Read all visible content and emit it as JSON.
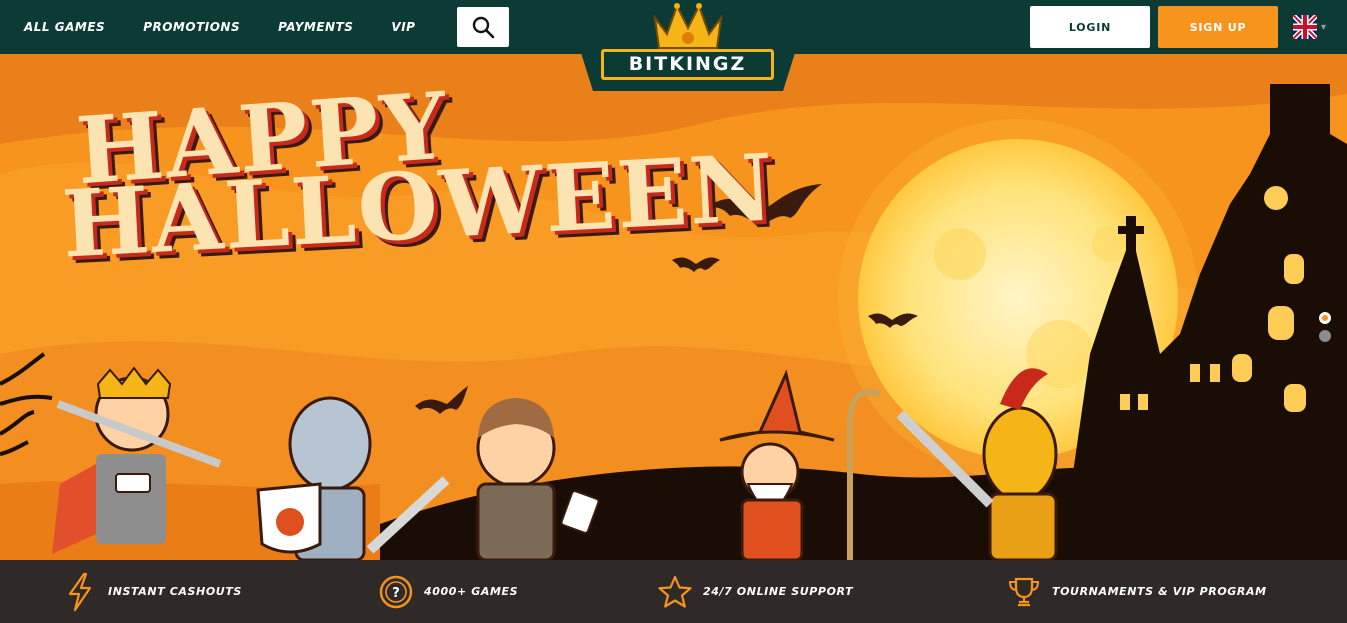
{
  "nav": {
    "items": [
      {
        "label": "ALL GAMES"
      },
      {
        "label": "PROMOTIONS"
      },
      {
        "label": "PAYMENTS"
      },
      {
        "label": "VIP"
      }
    ]
  },
  "logo": {
    "text": "BITKINGZ"
  },
  "auth": {
    "login_label": "LOGIN",
    "signup_label": "SIGN UP"
  },
  "language": {
    "flag": "uk-flag-icon"
  },
  "hero": {
    "headline_line1": "HAPPY",
    "headline_line2": "HALLOWEEN",
    "slides": {
      "count": 2,
      "active": 0
    }
  },
  "features": [
    {
      "icon": "lightning-icon",
      "label": "INSTANT CASHOUTS"
    },
    {
      "icon": "question-circle-icon",
      "label": "4000+ GAMES"
    },
    {
      "icon": "star-icon",
      "label": "24/7 ONLINE SUPPORT"
    },
    {
      "icon": "trophy-icon",
      "label": "TOURNAMENTS & VIP PROGRAM"
    }
  ],
  "colors": {
    "header_bg": "#0b3b34",
    "accent_orange": "#f7941d",
    "features_bg": "#2f2a28",
    "logo_gold": "#f5b516"
  }
}
